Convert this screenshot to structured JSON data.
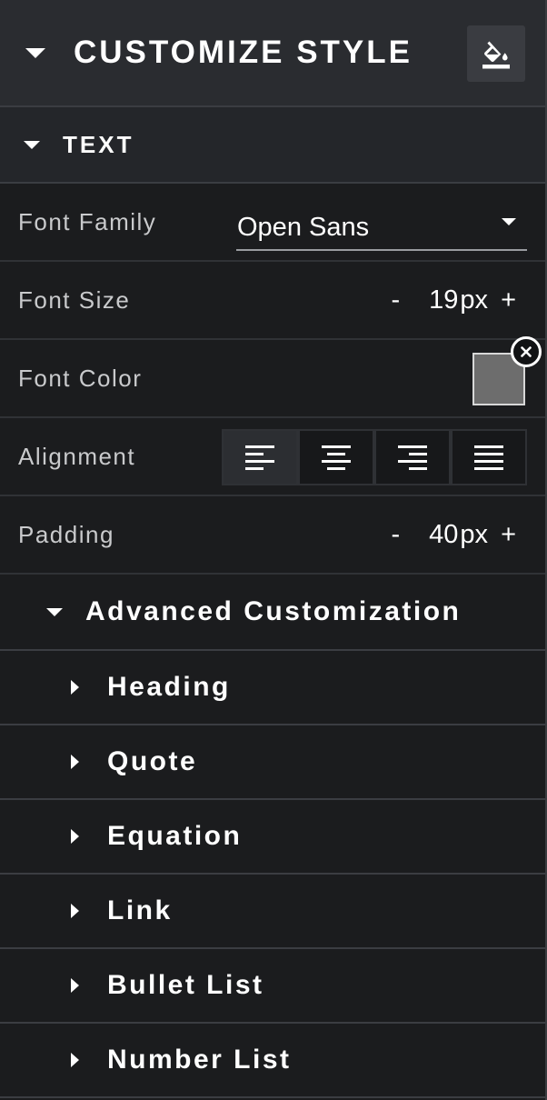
{
  "header": {
    "title": "CUSTOMIZE STYLE",
    "paint_icon": "paint-bucket-icon"
  },
  "text_section": {
    "title": "TEXT",
    "font_family": {
      "label": "Font Family",
      "value": "Open Sans"
    },
    "font_size": {
      "label": "Font Size",
      "minus": "-",
      "value": "19",
      "unit": "px",
      "plus": "+"
    },
    "font_color": {
      "label": "Font Color",
      "swatch_color": "#6d6d6d"
    },
    "alignment": {
      "label": "Alignment",
      "options": [
        "left",
        "center",
        "right",
        "justify"
      ],
      "selected": "left"
    },
    "padding": {
      "label": "Padding",
      "minus": "-",
      "value": "40",
      "unit": "px",
      "plus": "+"
    }
  },
  "advanced": {
    "title": "Advanced Customization",
    "items": [
      {
        "label": "Heading"
      },
      {
        "label": "Quote"
      },
      {
        "label": "Equation"
      },
      {
        "label": "Link"
      },
      {
        "label": "Bullet List"
      },
      {
        "label": "Number List"
      }
    ]
  }
}
